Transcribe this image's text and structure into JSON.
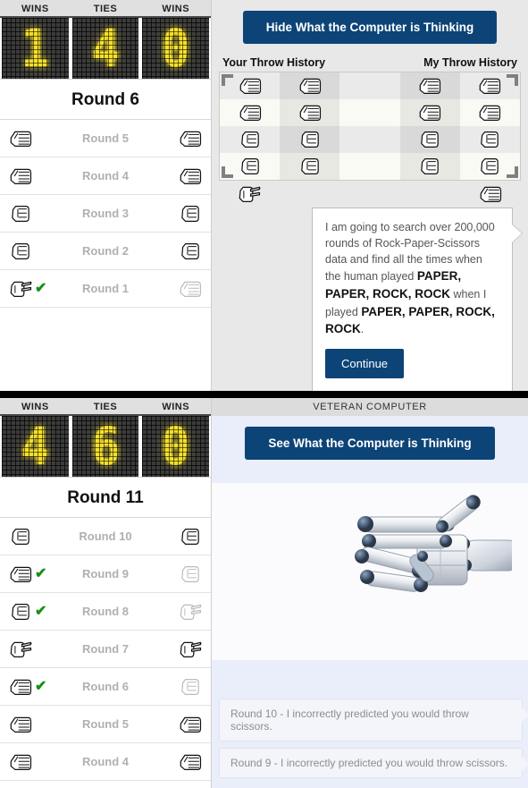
{
  "top_panel": {
    "scoreboard": [
      {
        "label": "WINS",
        "value": "1"
      },
      {
        "label": "TIES",
        "value": "4"
      },
      {
        "label": "WINS",
        "value": "0"
      }
    ],
    "round_heading": "Round 6",
    "rounds": [
      {
        "label": "Round 5",
        "player": "paper",
        "player_win": false,
        "computer": "paper",
        "computer_win": false
      },
      {
        "label": "Round 4",
        "player": "paper",
        "player_win": false,
        "computer": "paper",
        "computer_win": false
      },
      {
        "label": "Round 3",
        "player": "rock",
        "player_win": false,
        "computer": "rock",
        "computer_win": false
      },
      {
        "label": "Round 2",
        "player": "rock",
        "player_win": false,
        "computer": "rock",
        "computer_win": false
      },
      {
        "label": "Round 1",
        "player": "scissors",
        "player_win": true,
        "computer": "paper",
        "computer_win": false
      }
    ],
    "think_button": "Hide What the Computer is Thinking",
    "history": {
      "your_label": "Your Throw History",
      "my_label": "My Throw History",
      "rows": [
        {
          "cells": [
            "paper",
            "paper",
            "",
            "paper",
            "paper"
          ]
        },
        {
          "cells": [
            "paper",
            "paper",
            "",
            "paper",
            "paper"
          ]
        },
        {
          "cells": [
            "rock",
            "rock",
            "",
            "rock",
            "rock"
          ]
        },
        {
          "cells": [
            "rock",
            "rock",
            "",
            "rock",
            "rock"
          ]
        }
      ],
      "extra_row": {
        "cells": [
          "scissors",
          "",
          "",
          "",
          "paper"
        ]
      },
      "highlight_columns": [
        1,
        3
      ]
    },
    "bubble": {
      "segments": [
        {
          "text": "I am going to search over 200,000 rounds of Rock-Paper-Scissors data and find all the times when the human played ",
          "strong": false
        },
        {
          "text": "PAPER, PAPER, ROCK, ROCK",
          "strong": true
        },
        {
          "text": " when I played ",
          "strong": false
        },
        {
          "text": "PAPER, PAPER, ROCK, ROCK",
          "strong": true
        },
        {
          "text": ".",
          "strong": false
        }
      ],
      "continue_label": "Continue"
    }
  },
  "bottom_panel": {
    "scoreboard": [
      {
        "label": "WINS",
        "value": "4"
      },
      {
        "label": "TIES",
        "value": "6"
      },
      {
        "label": "WINS",
        "value": "0"
      }
    ],
    "round_heading": "Round 11",
    "rounds": [
      {
        "label": "Round 10",
        "player": "rock",
        "player_win": false,
        "computer": "rock",
        "computer_win": false
      },
      {
        "label": "Round 9",
        "player": "paper",
        "player_win": true,
        "computer": "rock",
        "computer_win": false
      },
      {
        "label": "Round 8",
        "player": "rock",
        "player_win": true,
        "computer": "scissors",
        "computer_win": false
      },
      {
        "label": "Round 7",
        "player": "scissors",
        "player_win": false,
        "computer": "scissors",
        "computer_win": false
      },
      {
        "label": "Round 6",
        "player": "paper",
        "player_win": true,
        "computer": "rock",
        "computer_win": false
      },
      {
        "label": "Round 5",
        "player": "paper",
        "player_win": false,
        "computer": "paper",
        "computer_win": false
      },
      {
        "label": "Round 4",
        "player": "paper",
        "player_win": false,
        "computer": "paper",
        "computer_win": false
      }
    ],
    "header_title": "VETERAN COMPUTER",
    "think_button": "See What the Computer is Thinking",
    "log": [
      "Round 10 - I incorrectly predicted you would throw scissors.",
      "Round 9 - I incorrectly predicted you would throw scissors."
    ]
  },
  "colors": {
    "accent_blue": "#0d4477",
    "led_yellow": "#f5e02a",
    "led_dark": "#3b3b3b",
    "win_check_green": "#169016",
    "bottom_bg": "#eaeefa"
  }
}
